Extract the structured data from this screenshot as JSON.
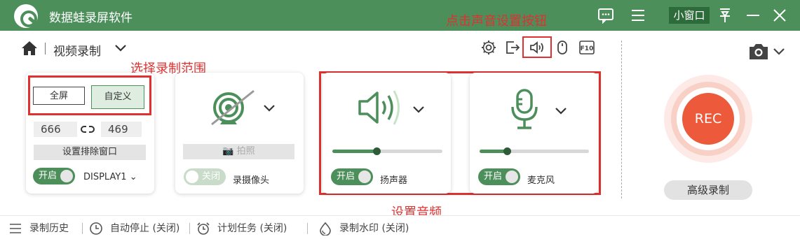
{
  "app": {
    "title": "数据蛙录屏软件",
    "mini_window_label": "小窗口"
  },
  "toolbar": {
    "mode_label": "视频录制"
  },
  "annotations": {
    "sound_settings": "点击声音设置按钮",
    "select_range": "选择录制范围",
    "set_audio": "设置音频"
  },
  "region": {
    "fullscreen_label": "全屏",
    "custom_label": "自定义",
    "width": "666",
    "height": "469",
    "exclude_window_label": "设置排除窗口",
    "toggle_label": "开启",
    "display_label": "DISPLAY1"
  },
  "webcam": {
    "photo_label": "拍照",
    "toggle_label": "关闭",
    "name": "录摄像头"
  },
  "speaker": {
    "toggle_label": "开启",
    "name": "扬声器",
    "volume": 0.4
  },
  "microphone": {
    "toggle_label": "开启",
    "name": "麦克风",
    "volume": 0.25
  },
  "record": {
    "rec_label": "REC",
    "advanced_label": "高级录制"
  },
  "bottom": {
    "history": "录制历史",
    "auto_stop": "自动停止 (关闭)",
    "schedule": "计划任务 (关闭)",
    "watermark": "录制水印 (关闭)"
  },
  "colors": {
    "brand": "#4d8f5b",
    "rec": "#ec5a3b",
    "annotation": "#e03030"
  }
}
